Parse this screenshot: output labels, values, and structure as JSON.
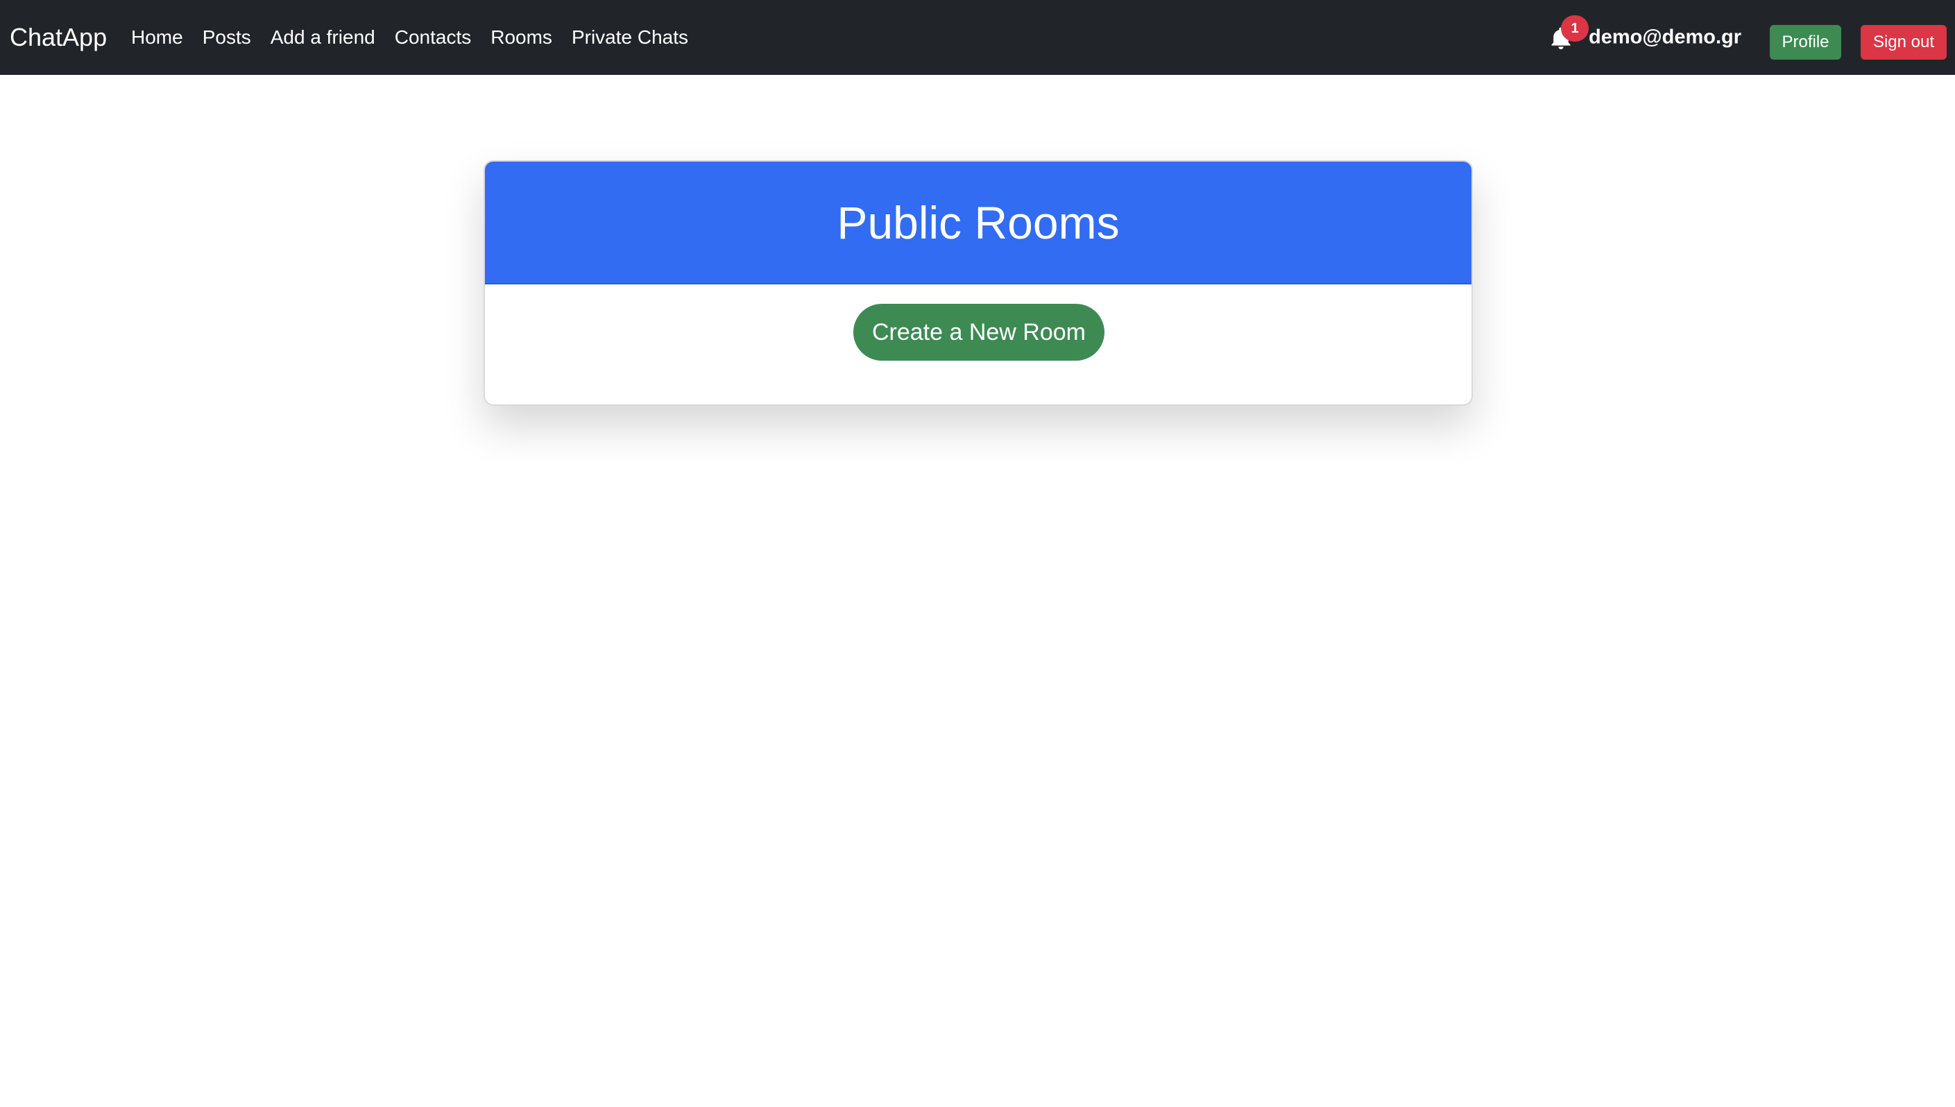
{
  "navbar": {
    "brand": "ChatApp",
    "links": [
      {
        "label": "Home"
      },
      {
        "label": "Posts"
      },
      {
        "label": "Add a friend"
      },
      {
        "label": "Contacts"
      },
      {
        "label": "Rooms"
      },
      {
        "label": "Private Chats"
      }
    ],
    "notifications": {
      "icon": "bell-icon",
      "count": "1"
    },
    "user_email": "demo@demo.gr",
    "profile_label": "Profile",
    "signout_label": "Sign out"
  },
  "main": {
    "card_title": "Public Rooms",
    "create_button_label": "Create a New Room"
  },
  "colors": {
    "navbar_bg": "#212529",
    "header_blue": "#326cf2",
    "success_green": "#3d8b53",
    "danger_red": "#dc3545"
  }
}
